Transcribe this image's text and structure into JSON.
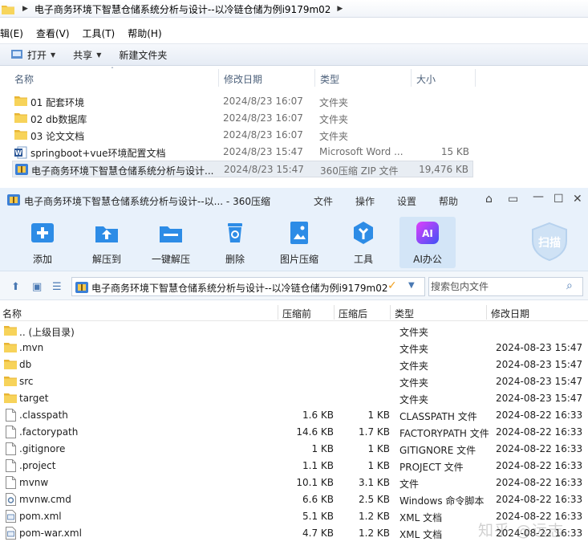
{
  "explorer": {
    "breadcrumb": [
      "电子商务环境下智慧仓储系统分析与设计--以冷链仓储为例i9179m02"
    ],
    "menu": [
      "辑(E)",
      "查看(V)",
      "工具(T)",
      "帮助(H)"
    ],
    "toolbar": {
      "open_label": "打开",
      "share_label": "共享",
      "new_folder_label": "新建文件夹"
    },
    "columns": [
      "名称",
      "修改日期",
      "类型",
      "大小"
    ],
    "rows": [
      {
        "name": "01 配套环境",
        "date": "2024/8/23 16:07",
        "type": "文件夹",
        "size": "",
        "icon": "folder-icon"
      },
      {
        "name": "02 db数据库",
        "date": "2024/8/23 16:07",
        "type": "文件夹",
        "size": "",
        "icon": "folder-icon"
      },
      {
        "name": "03 论文文档",
        "date": "2024/8/23 16:07",
        "type": "文件夹",
        "size": "",
        "icon": "folder-icon"
      },
      {
        "name": "springboot+vue环境配置文档",
        "date": "2024/8/23 15:47",
        "type": "Microsoft Word ...",
        "size": "15 KB",
        "icon": "word-doc-icon"
      },
      {
        "name": "电子商务环境下智慧仓储系统分析与设计...",
        "date": "2024/8/23 15:47",
        "type": "360压缩 ZIP 文件",
        "size": "19,476 KB",
        "icon": "zip-archive-icon"
      }
    ]
  },
  "zip": {
    "title": "电子商务环境下智慧仓储系统分析与设计--以... - 360压缩",
    "menu": [
      "文件",
      "操作",
      "设置",
      "帮助"
    ],
    "ribbon": [
      "添加",
      "解压到",
      "一键解压",
      "删除",
      "图片压缩",
      "工具",
      "AI办公"
    ],
    "scan_label": "扫描",
    "path": "电子商务环境下智慧仓储系统分析与设计--以冷链仓储为例i9179m02",
    "search_placeholder": "搜索包内文件",
    "columns": [
      "名称",
      "压缩前",
      "压缩后",
      "类型",
      "修改日期"
    ],
    "rows": [
      {
        "name": ".. (上级目录)",
        "before": "",
        "after": "",
        "type": "文件夹",
        "date": "",
        "icon": "folder-icon"
      },
      {
        "name": ".mvn",
        "before": "",
        "after": "",
        "type": "文件夹",
        "date": "2024-08-23 15:47",
        "icon": "folder-icon"
      },
      {
        "name": "db",
        "before": "",
        "after": "",
        "type": "文件夹",
        "date": "2024-08-23 15:47",
        "icon": "folder-icon"
      },
      {
        "name": "src",
        "before": "",
        "after": "",
        "type": "文件夹",
        "date": "2024-08-23 15:47",
        "icon": "folder-icon"
      },
      {
        "name": "target",
        "before": "",
        "after": "",
        "type": "文件夹",
        "date": "2024-08-23 15:47",
        "icon": "folder-icon"
      },
      {
        "name": ".classpath",
        "before": "1.6 KB",
        "after": "1 KB",
        "type": "CLASSPATH 文件",
        "date": "2024-08-22 16:33",
        "icon": "file-icon"
      },
      {
        "name": ".factorypath",
        "before": "14.6 KB",
        "after": "1.7 KB",
        "type": "FACTORYPATH 文件",
        "date": "2024-08-22 16:33",
        "icon": "file-icon"
      },
      {
        "name": ".gitignore",
        "before": "1 KB",
        "after": "1 KB",
        "type": "GITIGNORE 文件",
        "date": "2024-08-22 16:33",
        "icon": "file-icon"
      },
      {
        "name": ".project",
        "before": "1.1 KB",
        "after": "1 KB",
        "type": "PROJECT 文件",
        "date": "2024-08-22 16:33",
        "icon": "file-icon"
      },
      {
        "name": "mvnw",
        "before": "10.1 KB",
        "after": "3.1 KB",
        "type": "文件",
        "date": "2024-08-22 16:33",
        "icon": "file-icon"
      },
      {
        "name": "mvnw.cmd",
        "before": "6.6 KB",
        "after": "2.5 KB",
        "type": "Windows 命令脚本",
        "date": "2024-08-22 16:33",
        "icon": "cmd-script-icon"
      },
      {
        "name": "pom.xml",
        "before": "5.1 KB",
        "after": "1.2 KB",
        "type": "XML 文档",
        "date": "2024-08-22 16:33",
        "icon": "xml-file-icon"
      },
      {
        "name": "pom-war.xml",
        "before": "4.7 KB",
        "after": "1.2 KB",
        "type": "XML 文档",
        "date": "2024-08-22 16:33",
        "icon": "xml-file-icon"
      }
    ]
  },
  "watermark": "知乎 @远志"
}
